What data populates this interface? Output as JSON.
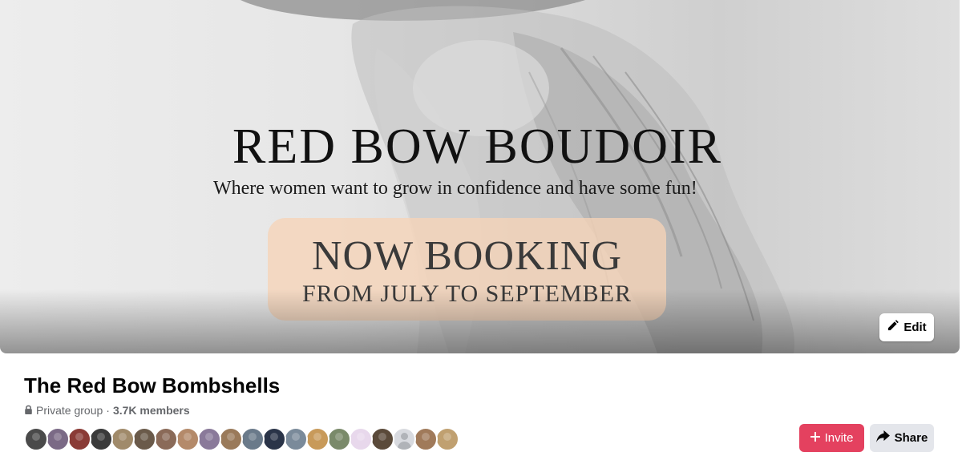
{
  "cover": {
    "title": "RED BOW BOUDOIR",
    "subtitle": "Where women want to grow in confidence and have some fun!",
    "booking_headline": "NOW BOOKING",
    "booking_dates": "FROM JULY TO SEPTEMBER",
    "edit_label": "Edit",
    "edit_icon": "pencil-icon"
  },
  "group": {
    "name": "The Red Bow Bombshells",
    "privacy": "Private group",
    "separator": "·",
    "members": "3.7K members",
    "privacy_icon": "lock-icon"
  },
  "avatars": [
    {
      "color": "#4a4a4a"
    },
    {
      "color": "#7b6a86"
    },
    {
      "color": "#8a3b36"
    },
    {
      "color": "#3a3a3a"
    },
    {
      "color": "#a08a6a"
    },
    {
      "color": "#6a5a4a"
    },
    {
      "color": "#8a6a58"
    },
    {
      "color": "#b48a6a"
    },
    {
      "color": "#8a7a9a"
    },
    {
      "color": "#9a7a5a"
    },
    {
      "color": "#6a7a8a"
    },
    {
      "color": "#2a3448"
    },
    {
      "color": "#7a8a9a"
    },
    {
      "color": "#c89a5a"
    },
    {
      "color": "#7a8a6a"
    },
    {
      "color": "#e8d8ec"
    },
    {
      "color": "#5a4a3a"
    },
    {
      "color": "#d8dadf",
      "default": true
    },
    {
      "color": "#a07a5a"
    },
    {
      "color": "#c0a070"
    }
  ],
  "actions": {
    "invite_label": "Invite",
    "invite_icon": "plus-icon",
    "share_label": "Share",
    "share_icon": "share-arrow-icon"
  },
  "colors": {
    "invite_bg": "#e4415f",
    "secondary_bg": "#e4e6eb",
    "booking_box": "#f6d3b7"
  }
}
